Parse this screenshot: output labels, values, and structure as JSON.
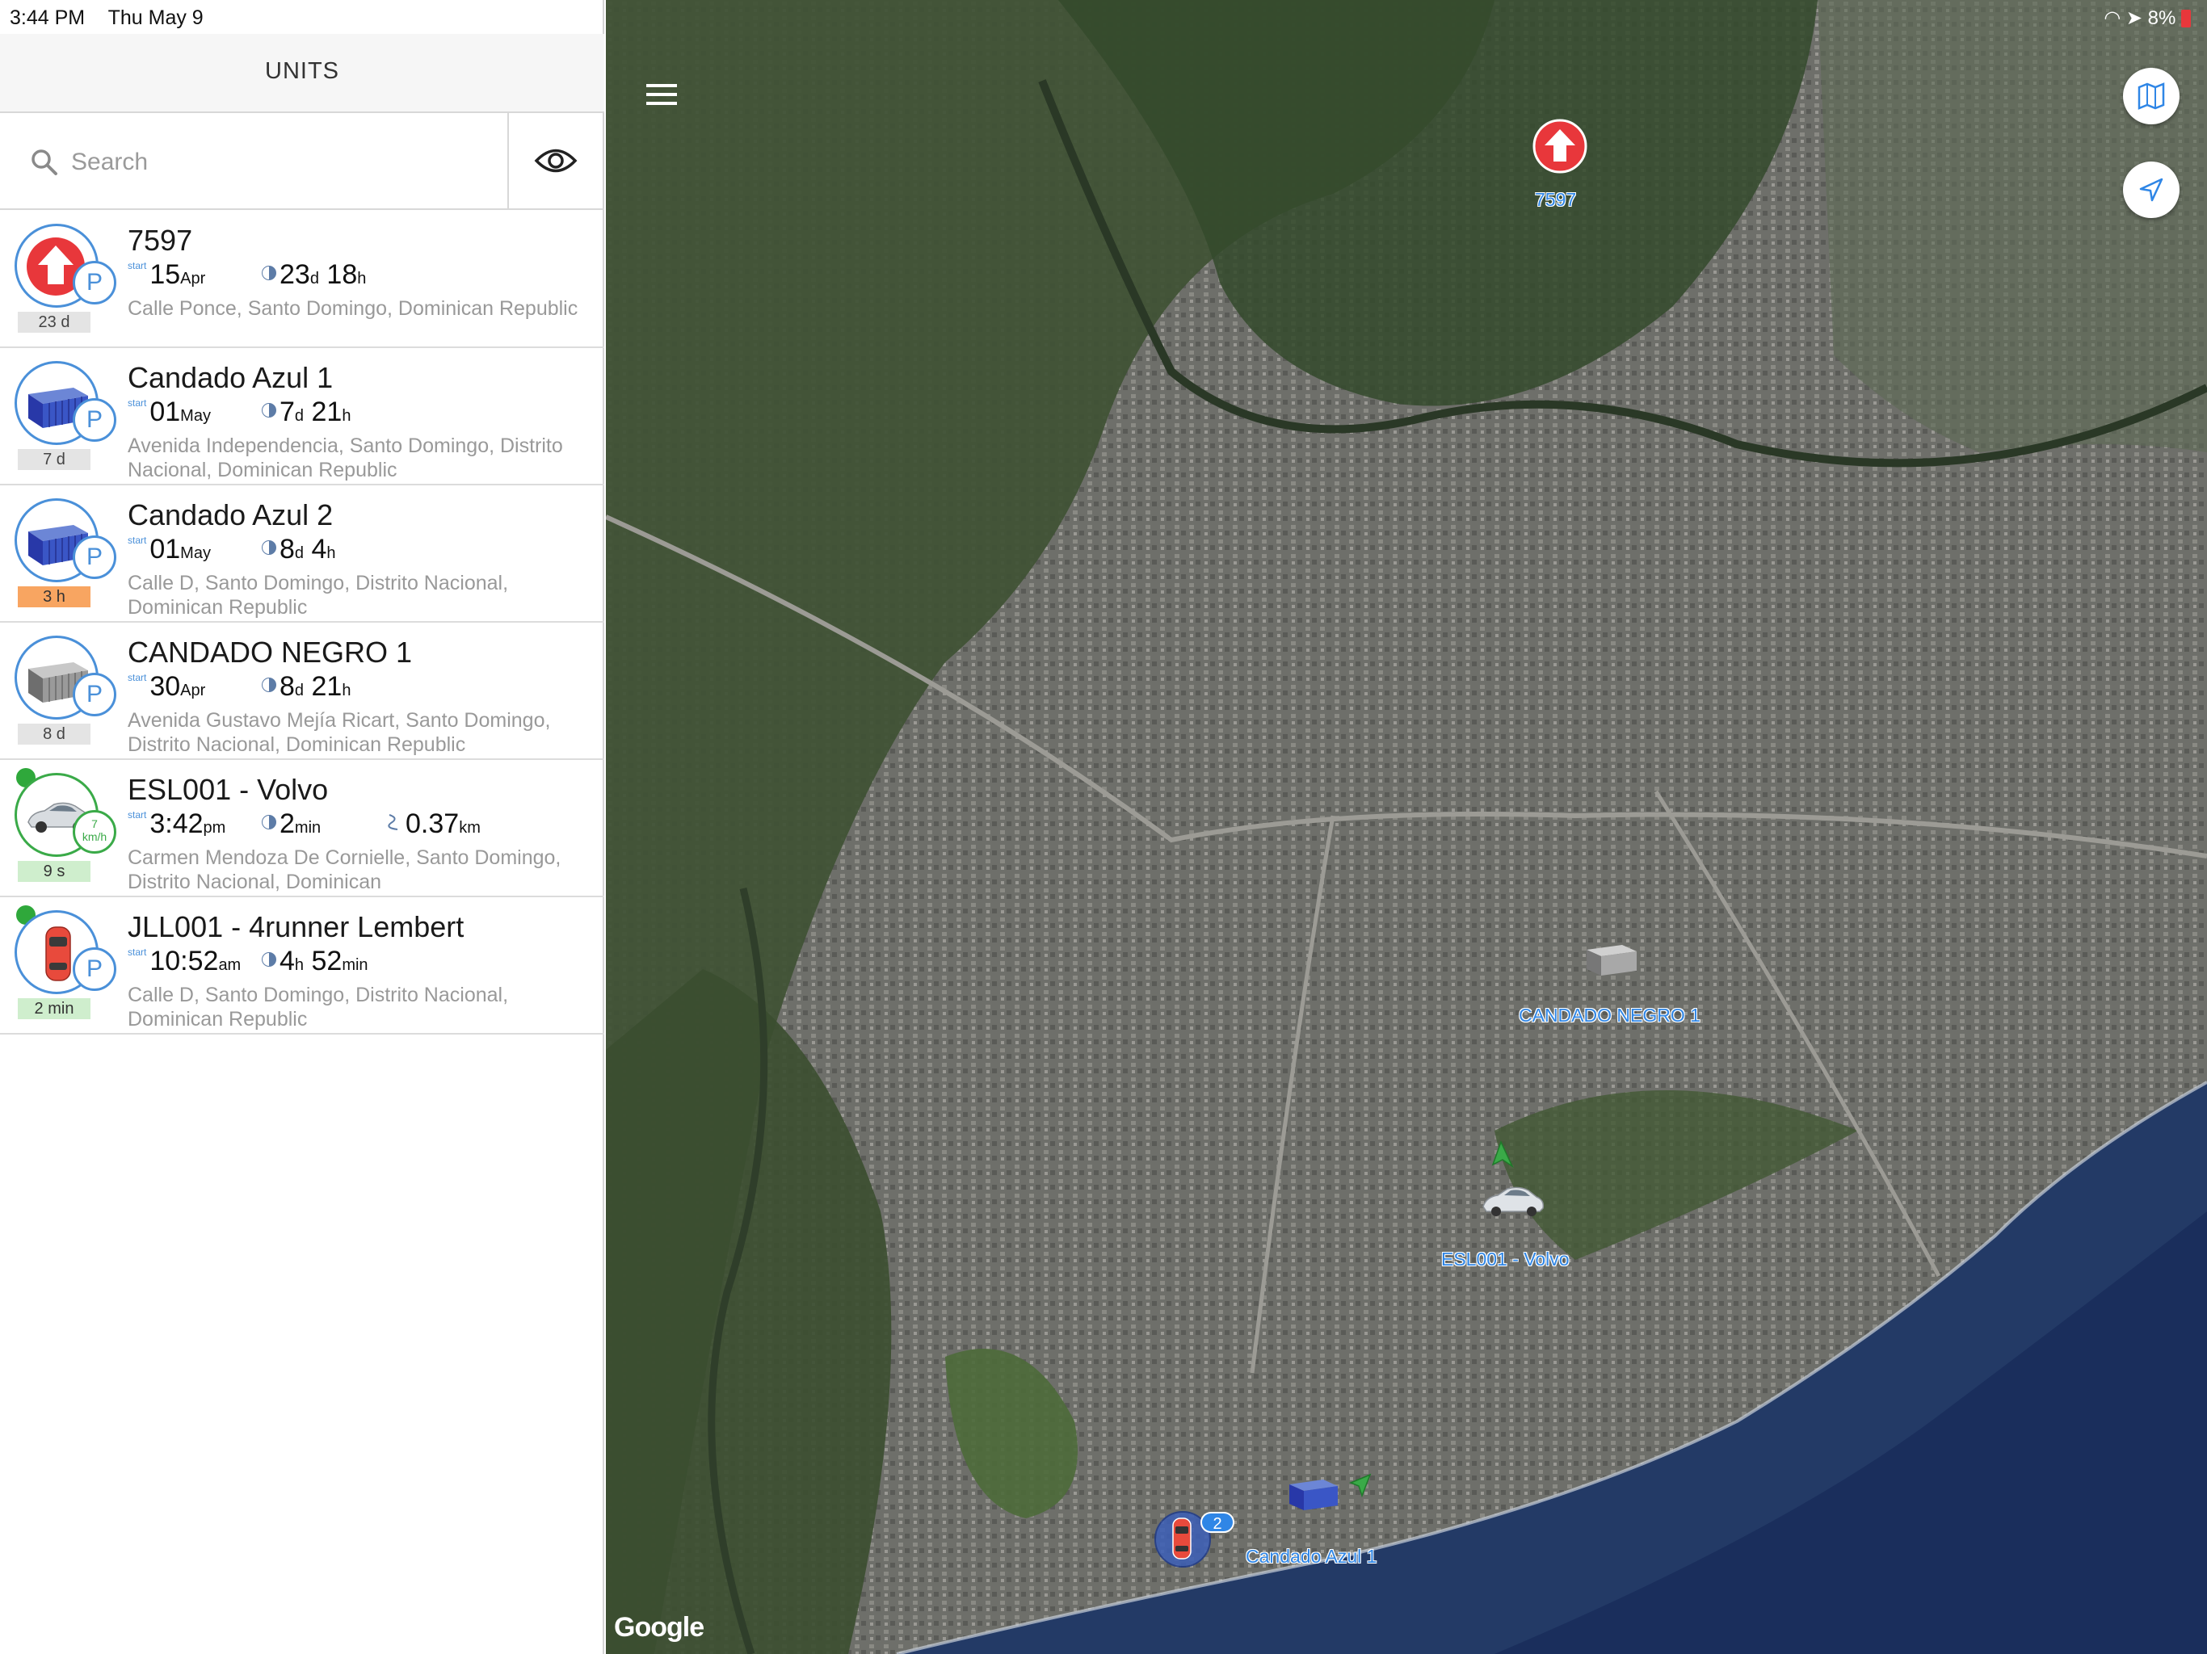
{
  "status": {
    "time": "3:44 PM",
    "date": "Thu May 9",
    "battery": "8%"
  },
  "header": {
    "title": "UNITS"
  },
  "search": {
    "placeholder": "Search"
  },
  "units": [
    {
      "name": "7597",
      "start_label": "start",
      "start_value": "15",
      "start_unit": "Apr",
      "duration": [
        {
          "v": "23",
          "u": "d"
        },
        {
          "v": "18",
          "u": "h"
        }
      ],
      "address": "Calle Ponce, Santo Domingo, Dominican Republic",
      "age": "23 d"
    },
    {
      "name": "Candado Azul 1",
      "start_label": "start",
      "start_value": "01",
      "start_unit": "May",
      "duration": [
        {
          "v": "7",
          "u": "d"
        },
        {
          "v": "21",
          "u": "h"
        }
      ],
      "address": "Avenida Independencia, Santo Domingo, Distrito Nacional, Dominican Republic",
      "age": "7 d"
    },
    {
      "name": "Candado Azul 2",
      "start_label": "start",
      "start_value": "01",
      "start_unit": "May",
      "duration": [
        {
          "v": "8",
          "u": "d"
        },
        {
          "v": "4",
          "u": "h"
        }
      ],
      "address": "Calle D, Santo Domingo, Distrito Nacional, Dominican Republic",
      "age": "3 h"
    },
    {
      "name": "CANDADO NEGRO 1",
      "start_label": "start",
      "start_value": "30",
      "start_unit": "Apr",
      "duration": [
        {
          "v": "8",
          "u": "d"
        },
        {
          "v": "21",
          "u": "h"
        }
      ],
      "address": "Avenida Gustavo Mejía Ricart, Santo Domingo, Distrito Nacional, Dominican Republic",
      "age": "8 d"
    },
    {
      "name": "ESL001 - Volvo",
      "start_label": "start",
      "start_value": "3:42",
      "start_unit": "pm",
      "duration": [
        {
          "v": "2",
          "u": "min"
        }
      ],
      "distance": "0.37",
      "distance_unit": "km",
      "speed": "7",
      "speed_unit": "km/h",
      "address": "Carmen Mendoza De Cornielle, Santo Domingo, Distrito Nacional, Dominican",
      "age": "9 s"
    },
    {
      "name": "JLL001 - 4runner Lembert",
      "start_label": "start",
      "start_value": "10:52",
      "start_unit": "am",
      "duration": [
        {
          "v": "4",
          "u": "h"
        },
        {
          "v": "52",
          "u": "min"
        }
      ],
      "address": "Calle D, Santo Domingo, Distrito Nacional, Dominican Republic",
      "age": "2 min"
    }
  ],
  "map": {
    "labels": {
      "u7597": "7597",
      "negro": "CANDADO NEGRO 1",
      "volvo": "ESL001 - Volvo",
      "azul": "Candado Azul 1",
      "cluster_count": "2"
    },
    "brand": "Google"
  },
  "colors": {
    "accent": "#4a90d9",
    "alert": "#e8373b",
    "moving": "#3aaa48",
    "age_warn": "#f8a561"
  }
}
